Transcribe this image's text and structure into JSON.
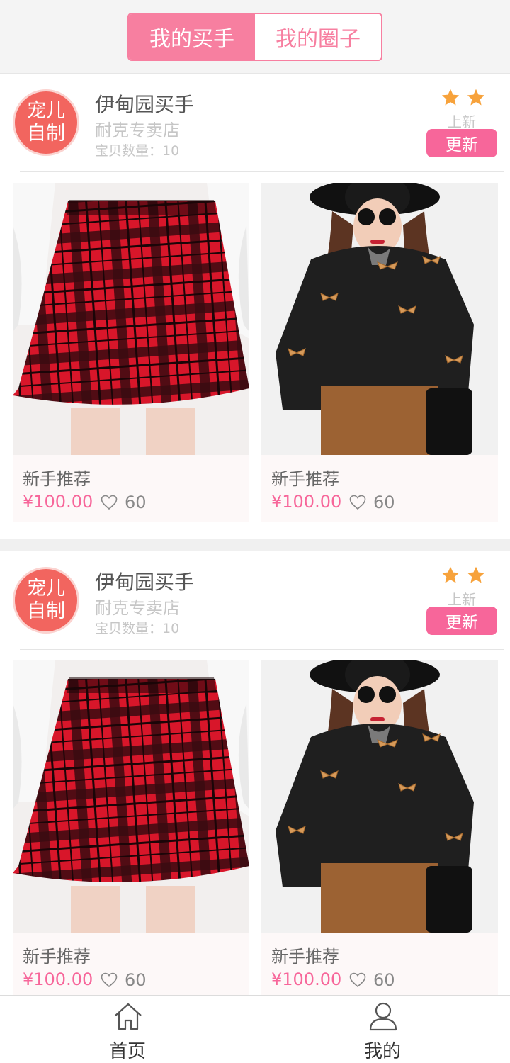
{
  "tabs": [
    {
      "label": "我的买手",
      "active": true
    },
    {
      "label": "我的圈子",
      "active": false
    }
  ],
  "shops": [
    {
      "logo_text": "宠儿\n自制",
      "name": "伊甸园买手",
      "subtitle": "耐克专卖店",
      "count_text": "宝贝数量：10",
      "star_count": 2,
      "new_label": "上新",
      "update_label": "更新",
      "products": [
        {
          "title": "新手推荐",
          "price": "¥100.00",
          "likes": "60",
          "image": "red-plaid-skirt"
        },
        {
          "title": "新手推荐",
          "price": "¥100.00",
          "likes": "60",
          "image": "black-bow-sweater"
        }
      ]
    },
    {
      "logo_text": "宠儿\n自制",
      "name": "伊甸园买手",
      "subtitle": "耐克专卖店",
      "count_text": "宝贝数量：10",
      "star_count": 2,
      "new_label": "上新",
      "update_label": "更新",
      "products": [
        {
          "title": "新手推荐",
          "price": "¥100.00",
          "likes": "60",
          "image": "red-plaid-skirt"
        },
        {
          "title": "新手推荐",
          "price": "¥100.00",
          "likes": "60",
          "image": "black-bow-sweater"
        }
      ]
    }
  ],
  "nav": [
    {
      "label": "首页",
      "icon": "home-icon"
    },
    {
      "label": "我的",
      "icon": "user-icon"
    }
  ],
  "colors": {
    "accent": "#f77fa0",
    "button": "#f7669a",
    "logo": "#f2655f",
    "star": "#f7a23b"
  }
}
